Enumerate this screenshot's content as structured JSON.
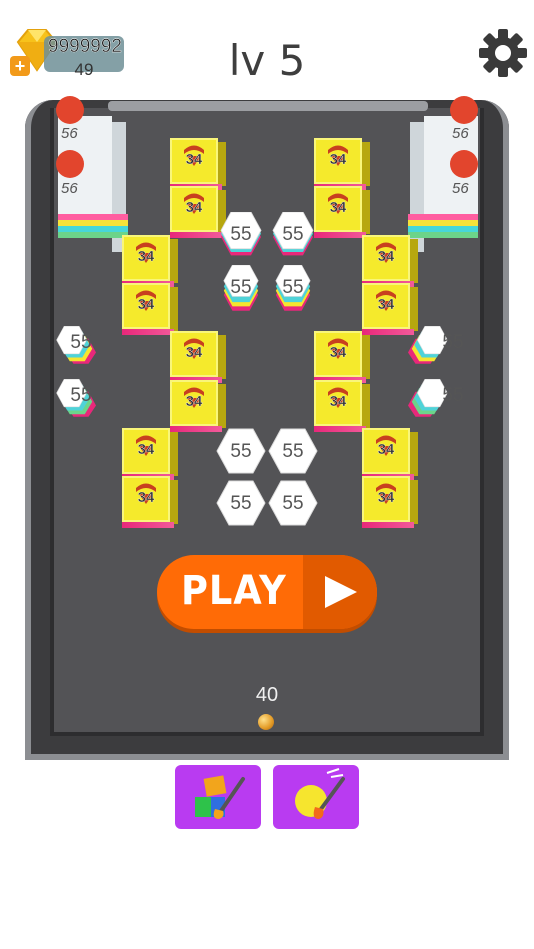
{
  "hud": {
    "coins": "9999992",
    "sub_count": "49",
    "level": "lv 5"
  },
  "board": {
    "yellow_value": "34",
    "hex_value": "55",
    "corner_value": "56"
  },
  "play_button": {
    "label": "PLAY"
  },
  "balls": {
    "count": "40"
  },
  "tools": [
    {
      "name": "color-palette-tool",
      "icon": "paint-swatches-icon"
    },
    {
      "name": "ball-skin-tool",
      "icon": "ball-brush-icon"
    }
  ],
  "colors": {
    "accent": "#ff6b06",
    "tool_bg": "#b93bf1",
    "block_yellow": "#f5ea2c",
    "board": "#535356"
  }
}
